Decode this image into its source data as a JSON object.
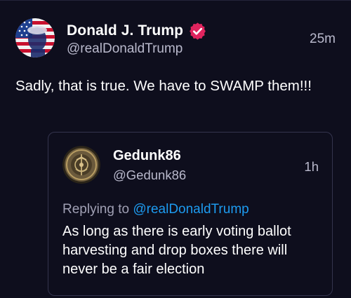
{
  "post": {
    "author_name": "Donald J. Trump",
    "author_handle": "@realDonaldTrump",
    "time": "25m",
    "verified": true,
    "text": "Sadly, that is true. We have to SWAMP them!!!"
  },
  "quote": {
    "author_name": "Gedunk86",
    "author_handle": "@Gedunk86",
    "time": "1h",
    "replying_prefix": "Replying to",
    "replying_handle": "@realDonaldTrump",
    "text": "As long as there is early voting ballot harvesting and drop boxes there will never be a fair election"
  },
  "colors": {
    "background": "#0e0e1d",
    "secondary_text": "#b9b9cc",
    "mention": "#1d9bf0",
    "verified_badge": "#e0245e",
    "border": "#34344e"
  },
  "icons": {
    "verified": "verified-badge-icon",
    "post_avatar": "flag-portrait-avatar",
    "quote_avatar": "emblem-seal-avatar"
  }
}
